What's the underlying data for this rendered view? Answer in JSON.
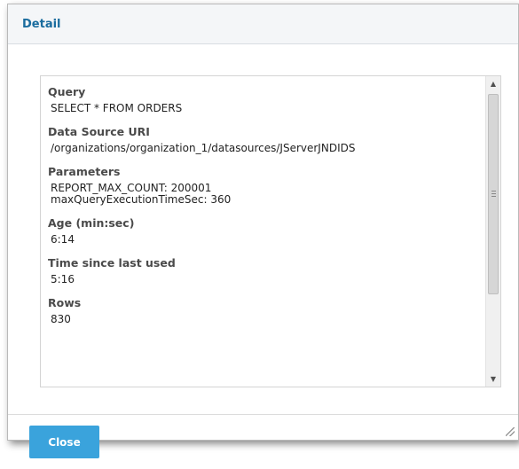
{
  "dialog": {
    "title": "Detail"
  },
  "details": {
    "fields": [
      {
        "label": "Query",
        "value": "SELECT * FROM ORDERS"
      },
      {
        "label": "Data Source URI",
        "value": "/organizations/organization_1/datasources/JServerJNDIDS"
      },
      {
        "label": "Parameters",
        "value": "REPORT_MAX_COUNT: 200001",
        "value2": "maxQueryExecutionTimeSec: 360"
      },
      {
        "label": "Age (min:sec)",
        "value": "6:14"
      },
      {
        "label": "Time since last used",
        "value": "5:16"
      },
      {
        "label": "Rows",
        "value": "830"
      }
    ]
  },
  "footer": {
    "close_label": "Close"
  },
  "colors": {
    "title": "#1a6c9e",
    "button": "#3aa3dc"
  }
}
